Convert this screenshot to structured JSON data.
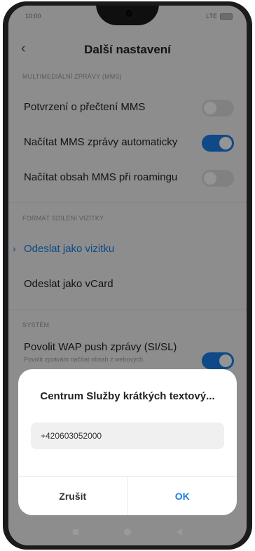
{
  "status_bar": {
    "time": "10:00",
    "network": "LTE"
  },
  "header": {
    "title": "Další nastavení"
  },
  "sections": {
    "mms": {
      "title": "MULTIMEDIÁLNÍ ZPRÁVY (MMS)",
      "items": [
        {
          "label": "Potvrzení o přečtení MMS",
          "toggle": "off"
        },
        {
          "label": "Načítat MMS zprávy automaticky",
          "toggle": "on"
        },
        {
          "label": "Načítat obsah MMS při roamingu",
          "toggle": "off"
        }
      ]
    },
    "vcard": {
      "title": "FORMÁT SDÍLENÍ VIZITKY",
      "items": [
        {
          "label": "Odeslat jako vizitku",
          "selected": true
        },
        {
          "label": "Odeslat jako vCard",
          "selected": false
        }
      ]
    },
    "system": {
      "title": "SYSTÉM",
      "items": [
        {
          "label": "Povolit WAP push zprávy (SI/SL)",
          "sublabel": "Povolit zprávám načítat obsah z webových",
          "toggle": "on"
        }
      ]
    }
  },
  "dialog": {
    "title": "Centrum Služby krátkých textový...",
    "input_value": "+420603052000",
    "cancel_label": "Zrušit",
    "ok_label": "OK"
  },
  "colors": {
    "accent": "#1a7fe8",
    "background": "#f3f3f3"
  }
}
